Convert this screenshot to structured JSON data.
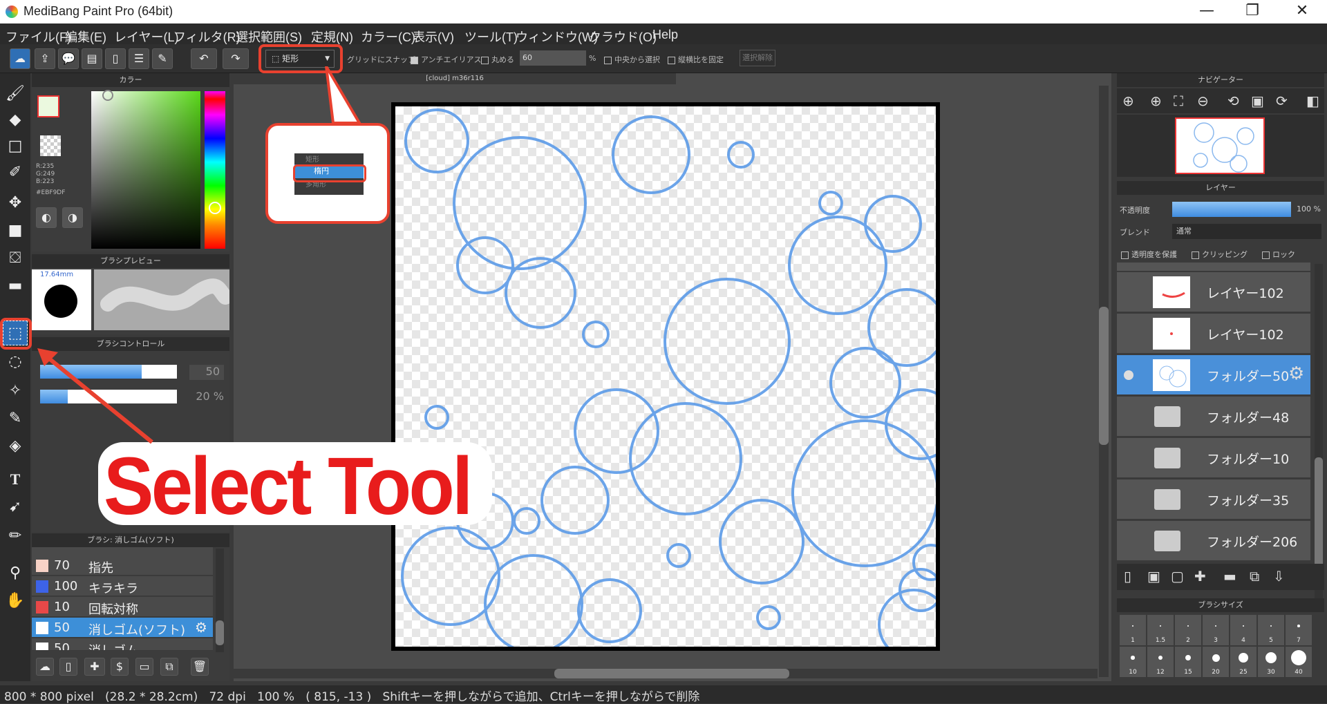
{
  "window": {
    "title": "MediBang Paint Pro (64bit)",
    "minimize": "—",
    "maximize": "❐",
    "close": "✕"
  },
  "menu": [
    "ファイル(F)",
    "編集(E)",
    "レイヤー(L)",
    "フィルタ(R)",
    "選択範囲(S)",
    "定規(N)",
    "カラー(C)",
    "表示(V)",
    "ツール(T)",
    "ウィンドウ(W)",
    "クラウド(O)",
    "Help"
  ],
  "toolbar": {
    "shape_select": "矩形",
    "snap": "グリッドにスナップ",
    "antialias": "アンチエイリアス",
    "round": "丸める",
    "round_value": "60",
    "percent": "%",
    "from_center": "中央から選択",
    "fix_ratio": "縦横比を固定",
    "cancel": "選択解除"
  },
  "dropdown_popup": {
    "items": [
      "矩形",
      "楕円",
      "多角形"
    ],
    "selected": "楕円"
  },
  "color_panel": {
    "title": "カラー",
    "rgb": "R:235\nG:249\nB:223",
    "hex": "#EBF9DF",
    "primary": "#EBF9DF"
  },
  "brush_preview": {
    "title": "ブラシプレビュー",
    "size": "17.64mm"
  },
  "brush_control": {
    "title": "ブラシコントロール",
    "size_value": "50",
    "opacity_value": "20 %",
    "size_fill": 0.74,
    "opacity_fill": 0.2
  },
  "brush_list": {
    "title": "ブラシ: 消しゴム(ソフト)",
    "items": [
      {
        "size": "70",
        "name": "指先",
        "color": "#f7d2c6"
      },
      {
        "size": "100",
        "name": "キラキラ",
        "color": "#3d63e8"
      },
      {
        "size": "10",
        "name": "回転対称",
        "color": "#e84848"
      },
      {
        "size": "50",
        "name": "消しゴム(ソフト)",
        "color": "#ffffff",
        "active": true
      },
      {
        "size": "50",
        "name": "消しゴム",
        "color": "#ffffff"
      }
    ]
  },
  "canvas_tab": "[cloud] m36r116",
  "annotation": "Select Tool",
  "navigator": {
    "title": "ナビゲーター"
  },
  "layers_panel": {
    "title": "レイヤー",
    "opacity_label": "不透明度",
    "opacity_value": "100 %",
    "blend_label": "ブレンド",
    "blend_value": "通常",
    "protect_alpha": "透明度を保護",
    "clipping": "クリッピング",
    "lock": "ロック",
    "layers": [
      {
        "name": "レイヤー102",
        "type": "layer"
      },
      {
        "name": "レイヤー102",
        "type": "layer"
      },
      {
        "name": "フォルダー50",
        "type": "folder-active"
      },
      {
        "name": "フォルダー48",
        "type": "folder"
      },
      {
        "name": "フォルダー10",
        "type": "folder"
      },
      {
        "name": "フォルダー35",
        "type": "folder"
      },
      {
        "name": "フォルダー206",
        "type": "folder"
      }
    ]
  },
  "brush_size_panel": {
    "title": "ブラシサイズ",
    "row1": [
      "1",
      "1.5",
      "2",
      "3",
      "4",
      "5",
      "7"
    ],
    "row2": [
      "10",
      "12",
      "15",
      "20",
      "25",
      "30",
      "40"
    ]
  },
  "status": "800 * 800 pixel   (28.2 * 28.2cm)   72 dpi   100 %   ( 815, -13 )   Shiftキーを押しながらで追加、Ctrlキーを押しながらで削除",
  "accent": "#4a90d9",
  "annotation_red": "#e8412f"
}
